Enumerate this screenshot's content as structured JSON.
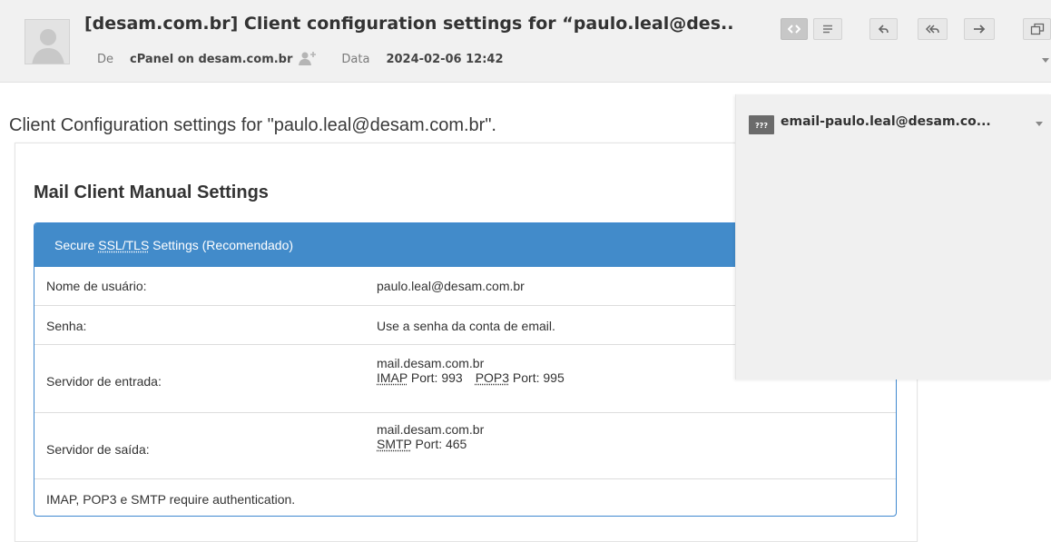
{
  "header": {
    "subject": "[desam.com.br] Client configuration settings for “paulo.leal@des..",
    "from_label": "De",
    "from_value": "cPanel on desam.com.br",
    "date_label": "Data",
    "date_value": "2024-02-06 12:42",
    "toolbar_icons": [
      "code-icon",
      "menu-icon",
      "reply-icon",
      "reply-all-icon",
      "forward-icon",
      "popout-icon"
    ]
  },
  "body": {
    "intro": "Client Configuration settings for \"paulo.leal@desam.com.br\".",
    "card_title": "Mail Client Manual Settings",
    "panel": {
      "heading_prefix": "Secure ",
      "heading_abbr": "SSL/TLS",
      "heading_suffix": " Settings (Recomendado)",
      "rows": [
        {
          "label": "Nome de usuário:",
          "value": "paulo.leal@desam.com.br"
        },
        {
          "label": "Senha:",
          "value": "Use a senha da conta de email."
        },
        {
          "label": "Servidor de entrada:",
          "host": "mail.desam.com.br",
          "p1_abbr": "IMAP",
          "p1_text": " Port: 993",
          "p2_abbr": "POP3",
          "p2_text": " Port: 995"
        },
        {
          "label": "Servidor de saída:",
          "host": "mail.desam.com.br",
          "p1_abbr": "SMTP",
          "p1_text": " Port: 465"
        },
        {
          "label": "IMAP, POP3 e SMTP require authentication."
        }
      ]
    }
  },
  "attachment": {
    "icon_text": "???",
    "name": "email-paulo.leal@desam.co..."
  },
  "colors": {
    "panel_header": "#428bca",
    "panel_border": "#3f88cf",
    "header_bg": "#f1f1f1",
    "attachment_bg": "#f0f0f0"
  }
}
